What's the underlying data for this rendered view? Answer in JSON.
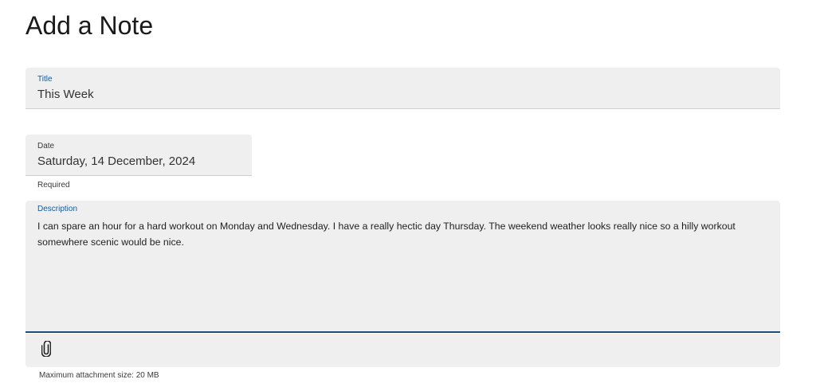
{
  "page": {
    "title": "Add a Note"
  },
  "title_field": {
    "label": "Title",
    "value": "This Week"
  },
  "date_field": {
    "label": "Date",
    "value": "Saturday, 14 December, 2024",
    "helper": "Required"
  },
  "description_field": {
    "label": "Description",
    "value": "I can spare an hour for a hard workout on Monday and Wednesday. I have a really hectic day Thursday. The weekend weather looks really nice so a hilly workout somewhere scenic would be nice."
  },
  "attachment": {
    "icon": "paperclip-icon",
    "helper": "Maximum attachment size: 20 MB"
  },
  "colors": {
    "accent": "#0b5cab",
    "field_bg": "#efefef",
    "active_underline": "#1d4e7a"
  }
}
